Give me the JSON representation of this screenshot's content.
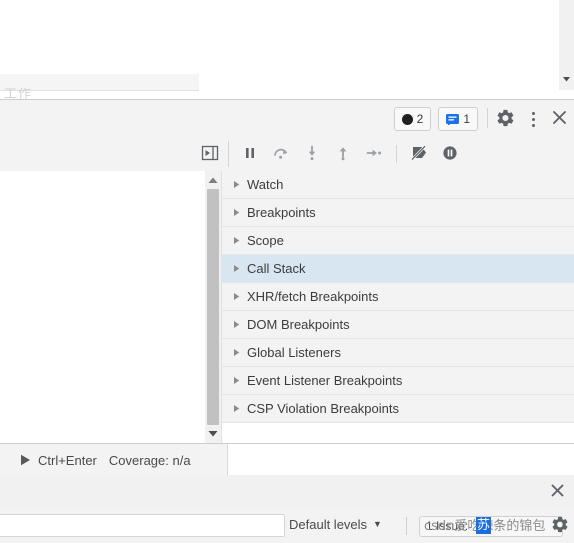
{
  "window": {
    "app": "Chrome DevTools",
    "faint_page_text": "工作"
  },
  "topbar": {
    "errors_badge": {
      "icon": "error-circle-icon",
      "count": "2"
    },
    "messages_badge": {
      "icon": "message-box-icon",
      "count": "1"
    },
    "settings_icon": "gear-icon",
    "more_icon": "kebab-menu-icon",
    "close_icon": "close-icon"
  },
  "debugger_toolbar": {
    "show_panel_icon": "show-debugger-sidebar-icon",
    "buttons": [
      {
        "name": "pause-script-execution",
        "icon": "pause-icon"
      },
      {
        "name": "step-over-next-function-call",
        "icon": "step-over-icon"
      },
      {
        "name": "step-into-next-function-call",
        "icon": "step-into-icon"
      },
      {
        "name": "step-out-of-current-function",
        "icon": "step-out-icon"
      },
      {
        "name": "step",
        "icon": "step-icon"
      },
      {
        "name": "deactivate-breakpoints",
        "icon": "deactivate-breakpoints-icon"
      },
      {
        "name": "pause-on-exceptions",
        "icon": "pause-on-exceptions-icon"
      }
    ]
  },
  "sidebar_tree": {
    "items": [
      {
        "label": "Watch",
        "expanded": false,
        "selected": false
      },
      {
        "label": "Breakpoints",
        "expanded": false,
        "selected": false
      },
      {
        "label": "Scope",
        "expanded": false,
        "selected": false
      },
      {
        "label": "Call Stack",
        "expanded": false,
        "selected": true
      },
      {
        "label": "XHR/fetch Breakpoints",
        "expanded": false,
        "selected": false
      },
      {
        "label": "DOM Breakpoints",
        "expanded": false,
        "selected": false
      },
      {
        "label": "Global Listeners",
        "expanded": false,
        "selected": false
      },
      {
        "label": "Event Listener Breakpoints",
        "expanded": false,
        "selected": false
      },
      {
        "label": "CSP Violation Breakpoints",
        "expanded": false,
        "selected": false
      }
    ],
    "selection_color": "#d8e6f2"
  },
  "status_bar": {
    "run_icon": "play-triangle-icon",
    "shortcut": "Ctrl+Enter",
    "coverage": "Coverage: n/a"
  },
  "drawer": {
    "close_icon": "close-icon"
  },
  "console_bar": {
    "filter_value": "",
    "filter_placeholder": "",
    "levels_label": "Default levels",
    "levels_caret": "▼",
    "issues_label": "1 Issue:",
    "settings_icon": "gear-icon"
  },
  "watermark": {
    "text_plain": "csdn爱吃辣条的锦包",
    "text_highlight": "苏"
  }
}
